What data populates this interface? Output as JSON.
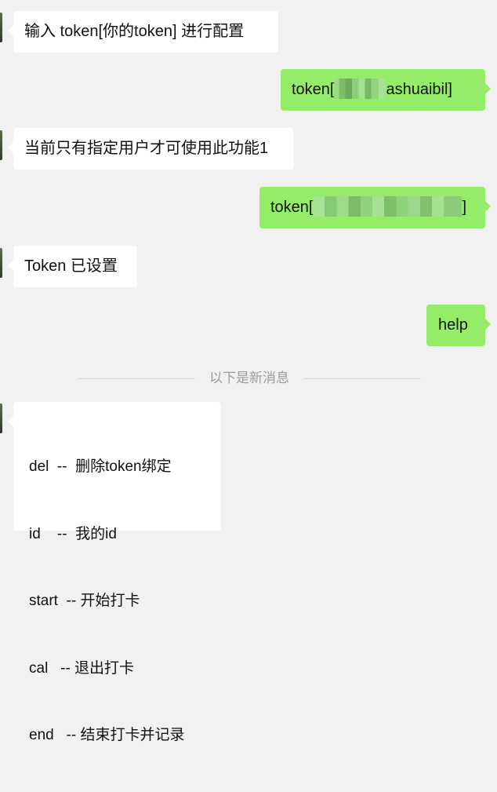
{
  "messages": {
    "m1": {
      "text": "输入 token[你的token] 进行配置"
    },
    "m2": {
      "prefix": "token[",
      "suffix": "ashuaibil]"
    },
    "m3": {
      "text": "当前只有指定用户才可使用此功能1"
    },
    "m4": {
      "prefix": "token[",
      "suffix": "]"
    },
    "m5": {
      "text": "Token 已设置"
    },
    "m6": {
      "text": "help"
    },
    "m7": {
      "lines": [
        "del  --  删除token绑定",
        "id    --  我的id",
        "start  -- 开始打卡",
        "cal   -- 退出打卡",
        "end   -- 结束打卡并记录"
      ]
    }
  },
  "divider": {
    "text": "以下是新消息"
  }
}
